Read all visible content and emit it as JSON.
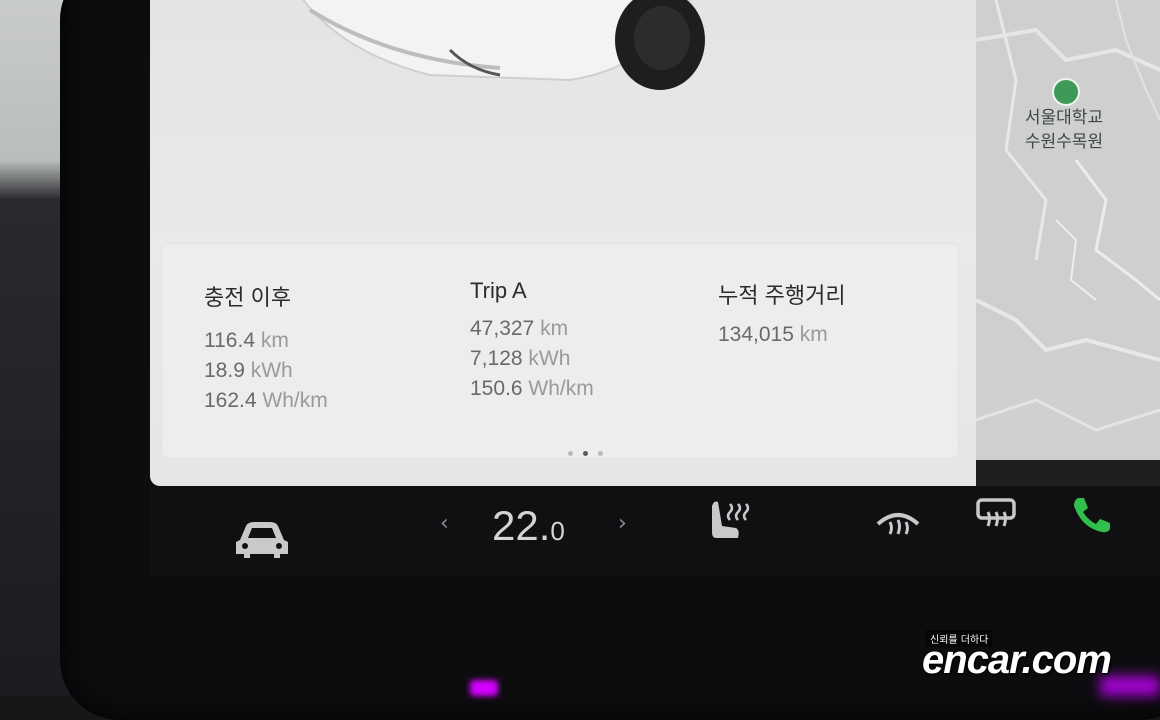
{
  "stats": {
    "since_charge": {
      "heading": "충전 이후",
      "distance_value": "116.4",
      "distance_unit": "km",
      "energy_value": "18.9",
      "energy_unit": "kWh",
      "efficiency_value": "162.4",
      "efficiency_unit": "Wh/km"
    },
    "trip_a": {
      "heading": "Trip A",
      "distance_value": "47,327",
      "distance_unit": "km",
      "energy_value": "7,128",
      "energy_unit": "kWh",
      "efficiency_value": "150.6",
      "efficiency_unit": "Wh/km"
    },
    "odometer": {
      "heading": "누적 주행거리",
      "distance_value": "134,015",
      "distance_unit": "km"
    }
  },
  "pager": {
    "total": 3,
    "active": 2
  },
  "map": {
    "poi_label_line1": "서울대학교",
    "poi_label_line2": "수원수목원",
    "poi_icon": "leaf-pin-icon"
  },
  "climate": {
    "temperature_whole": "22.",
    "temperature_decimal": "0",
    "decrease_glyph": "‹",
    "increase_glyph": "›"
  },
  "bottom_icons": [
    "car-icon",
    "seat-heater-icon",
    "front-defrost-icon",
    "rear-defrost-icon",
    "phone-icon"
  ],
  "colors": {
    "phone_green": "#2fbf4a",
    "map_pin_green": "#3e9a57"
  },
  "watermark": {
    "tagline": "신뢰를 더하다",
    "brand": "encar.com"
  }
}
